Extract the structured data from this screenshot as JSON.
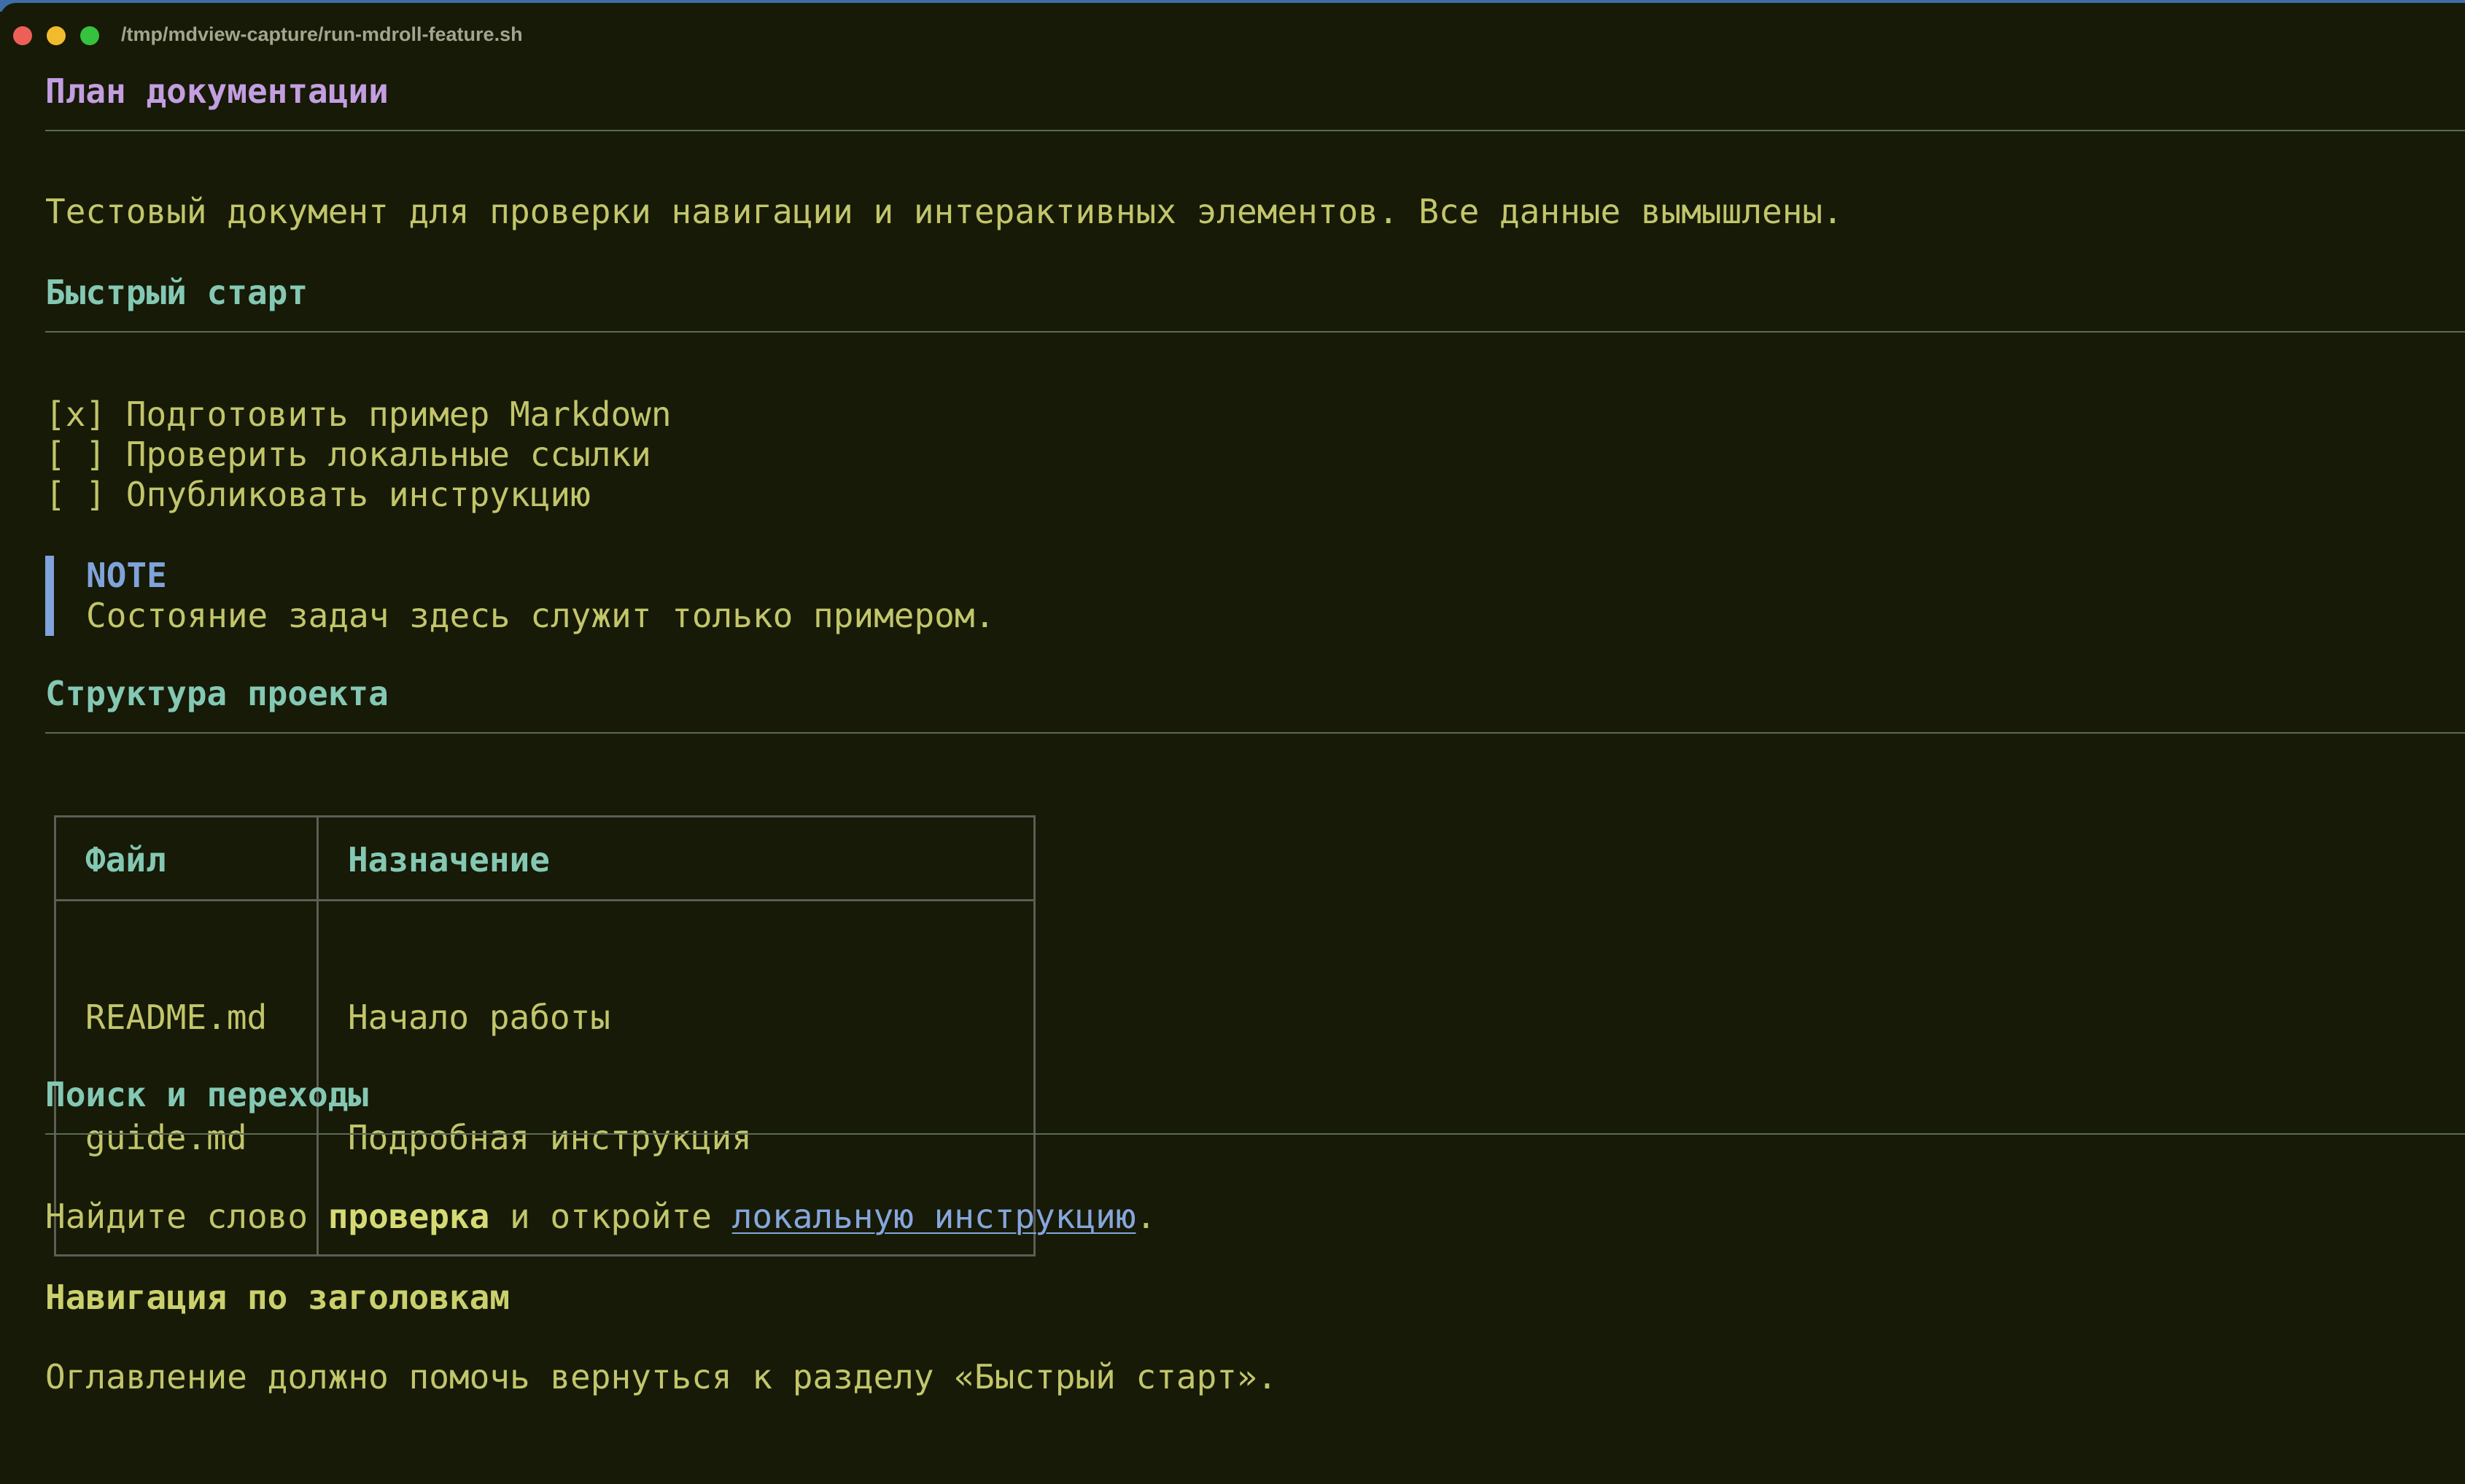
{
  "window": {
    "title": "/tmp/mdview-capture/run-mdroll-feature.sh"
  },
  "doc": {
    "title": "План документации",
    "intro": "Тестовый документ для проверки навигации и интерактивных элементов. Все данные вымышлены.",
    "quick_start": {
      "heading": "Быстрый старт",
      "tasks": [
        {
          "marker": "[x]",
          "label": "Подготовить пример Markdown",
          "checked": true
        },
        {
          "marker": "[ ]",
          "label": "Проверить локальные ссылки",
          "checked": false
        },
        {
          "marker": "[ ]",
          "label": "Опубликовать инструкцию",
          "checked": false
        }
      ],
      "note": {
        "label": "NOTE",
        "text": "Состояние задач здесь служит только примером."
      }
    },
    "structure": {
      "heading": "Структура проекта",
      "table": {
        "headers": [
          "Файл",
          "Назначение"
        ],
        "rows": [
          [
            "README.md",
            "Начало работы"
          ],
          [
            "guide.md",
            "Подробная инструкция"
          ]
        ]
      }
    },
    "search": {
      "heading": "Поиск и переходы",
      "text_before": "Найдите слово ",
      "bold_word": "проверка",
      "text_middle": " и откройте ",
      "link_text": "локальную инструкцию",
      "text_after": "."
    },
    "nav": {
      "heading": "Навигация по заголовкам",
      "text": "Оглавление должно помочь вернуться к разделу «Быстрый старт»."
    }
  },
  "colors": {
    "background": "#161a06",
    "text": "#c2c56a",
    "h1": "#c39ee0",
    "h2": "#84c8b4",
    "note_accent": "#7fa3da",
    "link": "#86a6dc"
  }
}
